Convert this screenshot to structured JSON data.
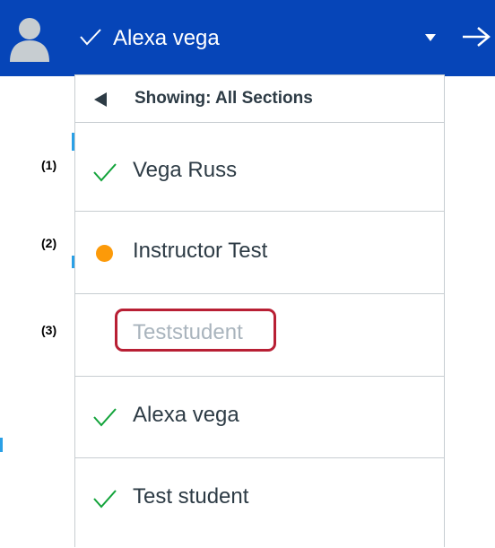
{
  "header": {
    "user_name": "Alexa vega"
  },
  "dropdown": {
    "section_label": "Showing: All Sections",
    "rows": [
      {
        "label": "Vega Russ",
        "status": "check",
        "muted": false
      },
      {
        "label": "Instructor Test",
        "status": "dot",
        "muted": false
      },
      {
        "label": "Teststudent",
        "status": "none",
        "muted": true
      },
      {
        "label": "Alexa vega",
        "status": "check",
        "muted": false
      },
      {
        "label": "Test student",
        "status": "check",
        "muted": false
      }
    ]
  },
  "callouts": [
    "(1)",
    "(2)",
    "(3)"
  ],
  "colors": {
    "header_bg": "#0645b8",
    "check_green": "#12a33a",
    "dot_orange": "#fc9a09",
    "highlight_red": "#b81f34",
    "muted_text": "#a9b4bd"
  },
  "icons": {
    "avatar": "user-avatar-icon",
    "header_check": "checkmark-icon",
    "caret": "caret-down-icon",
    "next": "arrow-right-icon",
    "back": "triangle-left-icon",
    "row_check": "checkmark-icon",
    "row_dot": "status-dot-icon"
  }
}
